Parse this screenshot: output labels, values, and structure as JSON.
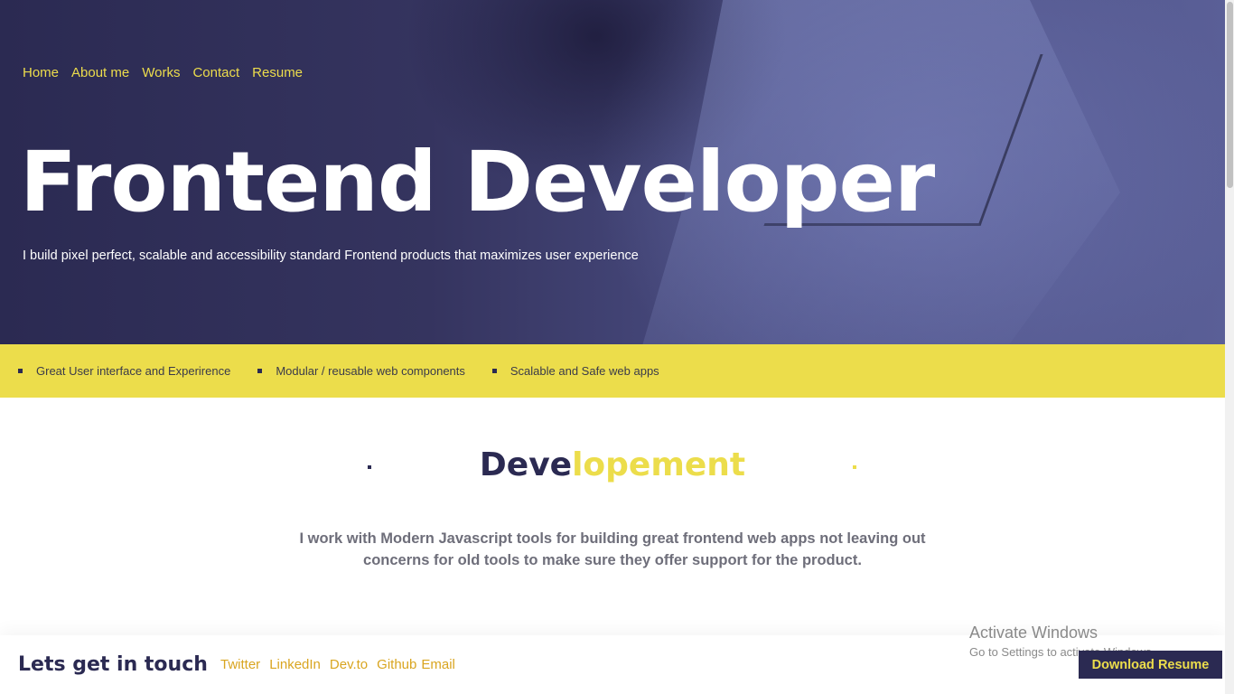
{
  "nav": {
    "items": [
      {
        "label": "Home"
      },
      {
        "label": "About me"
      },
      {
        "label": "Works"
      },
      {
        "label": "Contact"
      },
      {
        "label": "Resume"
      }
    ]
  },
  "hero": {
    "title": "Frontend Developer",
    "subtitle": "I build pixel perfect, scalable and accessibility standard Frontend products that maximizes user experience"
  },
  "features": [
    {
      "label": "Great User interface and Experirence"
    },
    {
      "label": "Modular / reusable web components"
    },
    {
      "label": "Scalable and Safe web apps"
    }
  ],
  "section": {
    "title_dark": "Deve",
    "title_yellow": "lopement",
    "text": "I work with Modern Javascript tools for building great frontend web apps not leaving out concerns for old tools to make sure they offer support for the product."
  },
  "footer": {
    "title": "Lets get in touch",
    "links": [
      {
        "label": "Twitter"
      },
      {
        "label": "LinkedIn"
      },
      {
        "label": "Dev.to"
      },
      {
        "label": "Github"
      },
      {
        "label": "Email"
      }
    ],
    "download_label": "Download Resume"
  },
  "watermark": {
    "line1": "Activate Windows",
    "line2": "Go to Settings to activate Windows."
  },
  "colors": {
    "accent_yellow": "#ecdd4b",
    "navy": "#2b2a52",
    "link_gold": "#d9a520"
  }
}
